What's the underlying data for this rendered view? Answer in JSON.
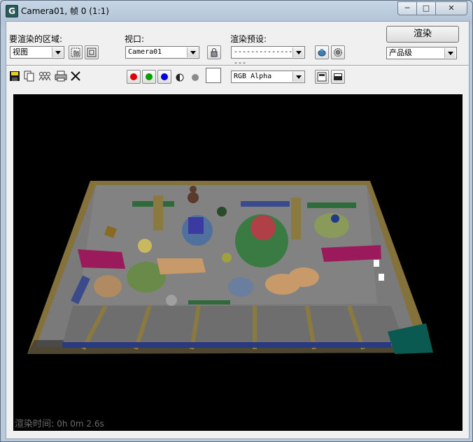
{
  "window": {
    "title": "Camera01, 帧 0 (1:1)",
    "buttons": {
      "minimize": "─",
      "maximize": "□",
      "close": "✕"
    }
  },
  "controls": {
    "area_label": "要渲染的区域:",
    "area_value": "视图",
    "viewport_label": "视口:",
    "viewport_value": "Camera01",
    "preset_label": "渲染预设:",
    "preset_value": "-------------------",
    "render_button": "渲染",
    "quality_value": "产品级",
    "channel_value": "RGB Alpha"
  },
  "status": {
    "render_time_label": "渲染时间:",
    "render_time_value": " 0h 0m 2.6s"
  },
  "colors": {
    "red": "#e00000",
    "green": "#00a000",
    "blue": "#0000e0"
  }
}
